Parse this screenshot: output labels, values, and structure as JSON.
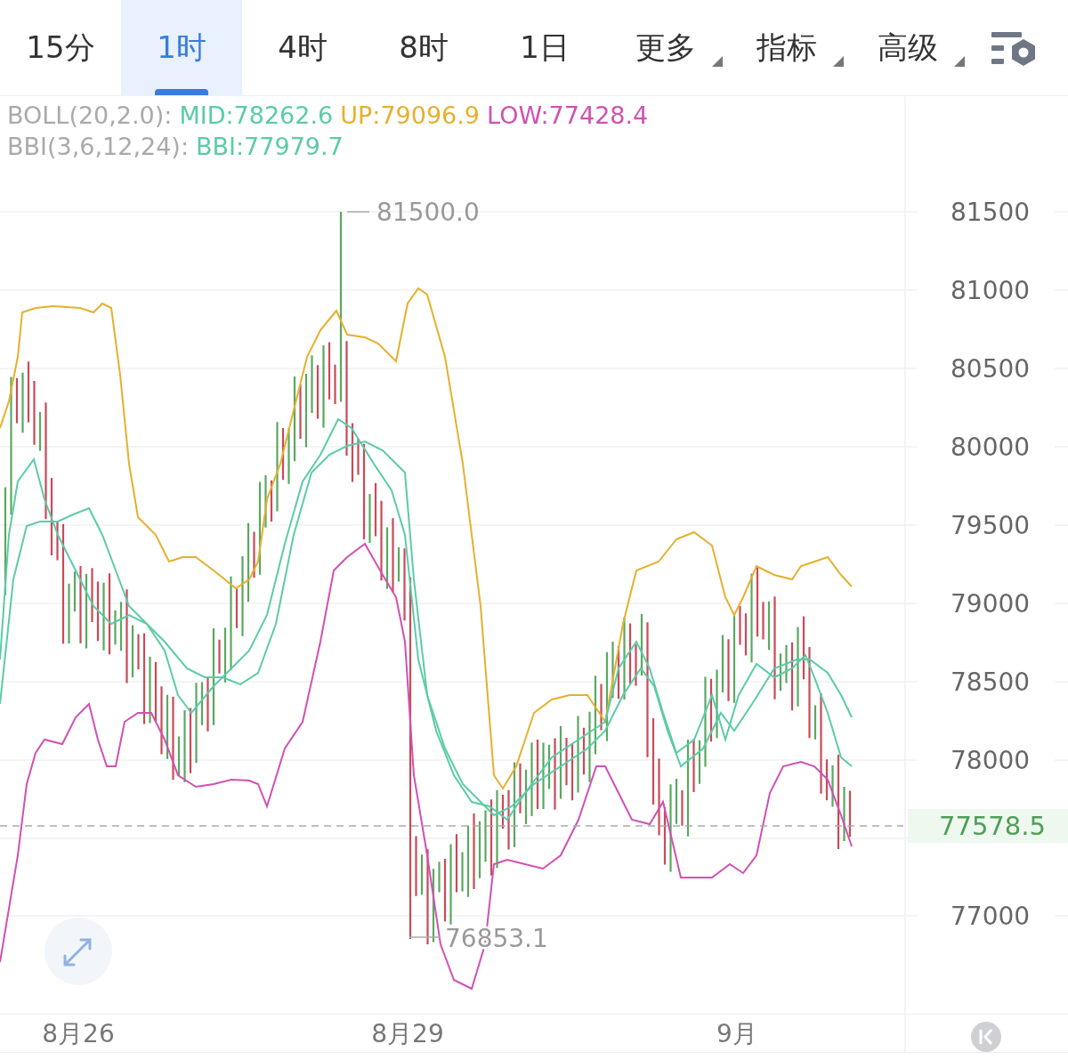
{
  "tabs": [
    {
      "label": "15分",
      "kind": "interval",
      "selected": false
    },
    {
      "label": "1时",
      "kind": "interval",
      "selected": true
    },
    {
      "label": "4时",
      "kind": "interval",
      "selected": false
    },
    {
      "label": "8时",
      "kind": "interval",
      "selected": false
    },
    {
      "label": "1日",
      "kind": "interval",
      "selected": false
    },
    {
      "label": "更多",
      "kind": "menu",
      "selected": false
    },
    {
      "label": "指标",
      "kind": "menu",
      "selected": false
    },
    {
      "label": "高级",
      "kind": "menu",
      "selected": false
    }
  ],
  "legend": [
    {
      "label": "BOLL(20,2.0):",
      "items": [
        {
          "text": "MID:78262.6",
          "color": "#5ccba8"
        },
        {
          "text": "UP:79096.9",
          "color": "#e6b02e"
        },
        {
          "text": "LOW:77428.4",
          "color": "#d051b3"
        }
      ]
    },
    {
      "label": "BBI(3,6,12,24):",
      "items": [
        {
          "text": "BBI:77979.7",
          "color": "#5ccba8"
        }
      ]
    }
  ],
  "chart": {
    "y_axis_labels": [
      "81500",
      "81000",
      "80500",
      "80000",
      "79500",
      "79000",
      "78500",
      "78000",
      "77000"
    ],
    "x_axis_labels": [
      "8月26",
      "8月29",
      "9月"
    ],
    "high_marker": "81500.0",
    "low_marker": "76853.1",
    "last_price": "77578.5"
  }
}
